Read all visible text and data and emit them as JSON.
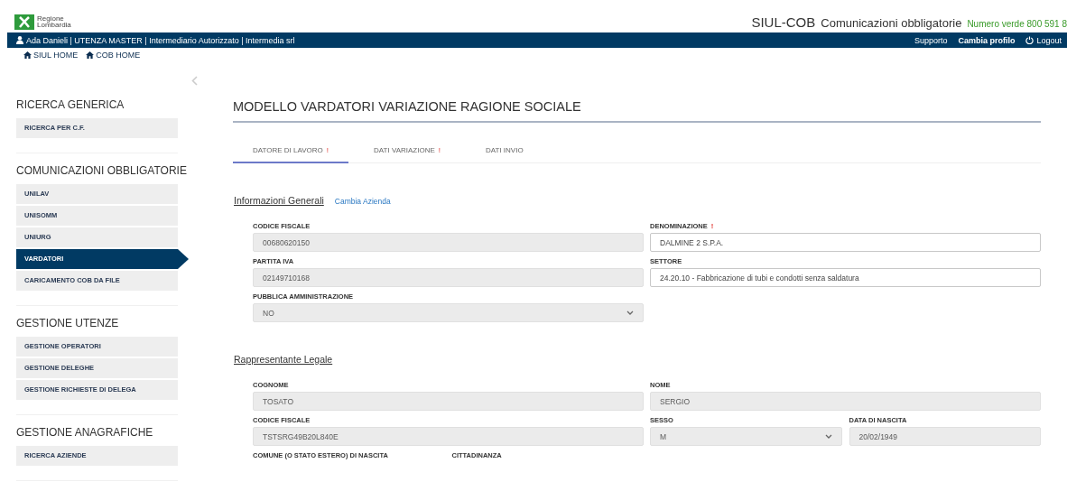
{
  "header": {
    "logo_lines": [
      "Regione",
      "Lombardia"
    ],
    "app_title": "SIUL-COB",
    "app_subtitle": "Comunicazioni obbligatorie",
    "hotline": "Numero verde 800 591 8"
  },
  "user_bar": {
    "user": "Ada Danieli | UTENZA MASTER | Intermediario Autorizzato | Intermedia srl",
    "links": [
      {
        "label": "Supporto",
        "kind": "plain"
      },
      {
        "label": "Cambia profilo",
        "kind": "bold"
      },
      {
        "label": "Logout",
        "kind": "power"
      }
    ]
  },
  "breadcrumbs": [
    {
      "label": "SIUL HOME"
    },
    {
      "label": "COB HOME"
    }
  ],
  "sidebar": {
    "sections": [
      {
        "title": "RICERCA GENERICA",
        "items": [
          {
            "label": "RICERCA PER C.F.",
            "selected": false
          }
        ]
      },
      {
        "title": "COMUNICAZIONI OBBLIGATORIE",
        "items": [
          {
            "label": "UNILAV",
            "selected": false
          },
          {
            "label": "UNISOMM",
            "selected": false
          },
          {
            "label": "UNIURG",
            "selected": false
          },
          {
            "label": "VARDATORI",
            "selected": true
          },
          {
            "label": "CARICAMENTO COB DA FILE",
            "selected": false
          }
        ]
      },
      {
        "title": "GESTIONE UTENZE",
        "items": [
          {
            "label": "GESTIONE OPERATORI",
            "selected": false
          },
          {
            "label": "GESTIONE DELEGHE",
            "selected": false
          },
          {
            "label": "GESTIONE RICHIESTE DI DELEGA",
            "selected": false
          }
        ]
      },
      {
        "title": "GESTIONE ANAGRAFICHE",
        "items": [
          {
            "label": "RICERCA AZIENDE",
            "selected": false
          }
        ]
      }
    ]
  },
  "page_title": "MODELLO VARDATORI VARIAZIONE RAGIONE SOCIALE",
  "tabs": [
    {
      "label": "DATORE DI LAVORO",
      "flag": "!",
      "selected": true
    },
    {
      "label": "DATI VARIAZIONE",
      "flag": "!",
      "selected": false
    },
    {
      "label": "DATI INVIO",
      "selected": false
    }
  ],
  "sections": [
    {
      "title": "Informazioni Generali",
      "link": "Cambia Azienda",
      "rows": [
        [
          [
            {
              "label": "CODICE FISCALE",
              "value": "00680620150",
              "kind": "text",
              "disabled": true
            }
          ],
          [
            {
              "label": "DENOMINAZIONE",
              "flag": "!",
              "value": "DALMINE 2 S.P.A.",
              "kind": "text",
              "disabled": false
            }
          ]
        ],
        [
          [
            {
              "label": "PARTITA IVA",
              "value": "02149710168",
              "kind": "text",
              "disabled": true
            }
          ],
          [
            {
              "label": "SETTORE",
              "value": "24.20.10 - Fabbricazione di tubi e condotti senza saldatura",
              "kind": "text",
              "disabled": false
            }
          ]
        ],
        [
          [
            {
              "label": "PUBBLICA AMMINISTRAZIONE",
              "value": "NO",
              "kind": "select",
              "disabled": true
            }
          ]
        ]
      ]
    },
    {
      "title": "Rappresentante Legale",
      "rows": [
        [
          [
            {
              "label": "COGNOME",
              "value": "TOSATO",
              "kind": "text",
              "disabled": true
            }
          ],
          [
            {
              "label": "NOME",
              "value": "SERGIO",
              "kind": "text",
              "disabled": true
            }
          ]
        ],
        [
          [
            {
              "label": "CODICE FISCALE",
              "value": "TSTSRG49B20L840E",
              "kind": "text",
              "disabled": true
            }
          ],
          [
            {
              "label": "SESSO",
              "value": "M",
              "kind": "select",
              "disabled": true
            },
            {
              "label": "DATA DI NASCITA",
              "value": "20/02/1949",
              "kind": "text",
              "disabled": true
            }
          ]
        ],
        [
          [
            {
              "label": "COMUNE (O STATO ESTERO) DI NASCITA"
            },
            {
              "label": "CITTADINANZA"
            }
          ]
        ]
      ]
    }
  ]
}
